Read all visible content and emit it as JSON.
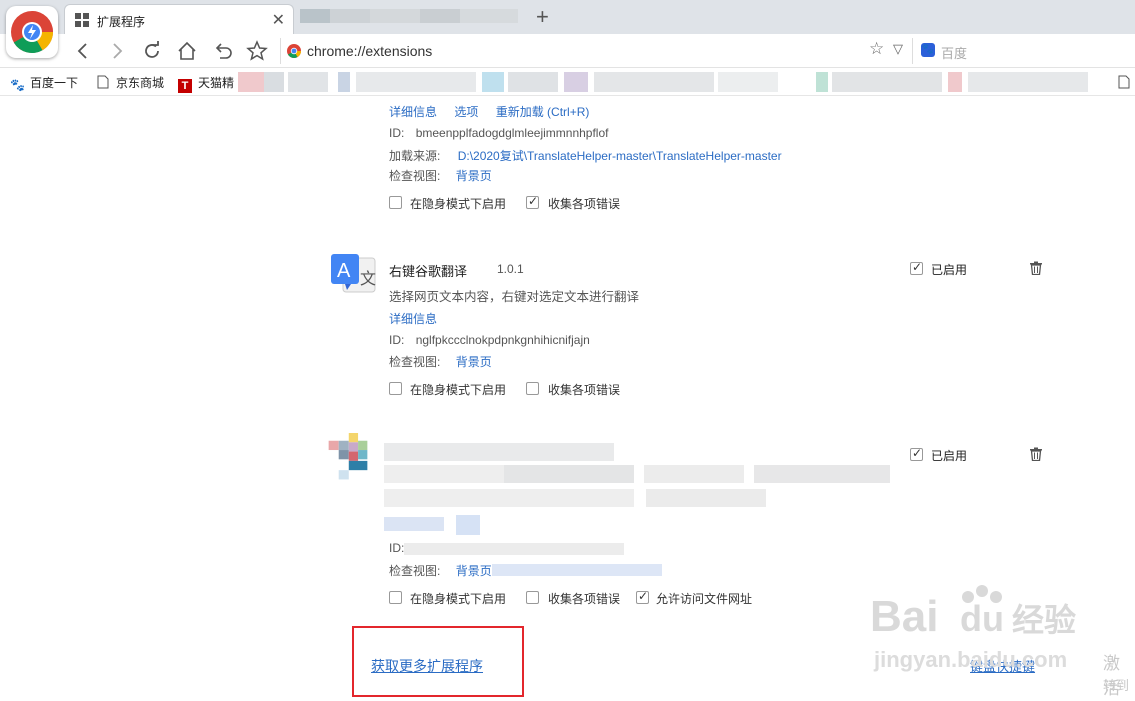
{
  "browser": {
    "tab_title": "扩展程序",
    "tab_close": "✕",
    "new_tab": "+",
    "url": "chrome://extensions",
    "search_placeholder": "百度",
    "omni_star": "☆",
    "omni_caret": "▽"
  },
  "bookmarks": [
    {
      "label": "百度一下",
      "icon": "baidu-paw-icon"
    },
    {
      "label": "京东商城",
      "icon": "page-icon"
    },
    {
      "label": "天猫精",
      "icon": "tmall-icon"
    }
  ],
  "ext1": {
    "links": [
      "详细信息",
      "选项",
      "重新加载 (Ctrl+R)"
    ],
    "id_label": "ID:",
    "id_value": "bmeenpplfadogdglmleejimmnnhpflof",
    "source_label": "加载来源:",
    "source_value": "D:\\2020复试\\TranslateHelper-master\\TranslateHelper-master",
    "views_label": "检查视图:",
    "views_link": "背景页",
    "incognito_label": "在隐身模式下启用",
    "incognito_checked": false,
    "errors_label": "收集各项错误",
    "errors_checked": true
  },
  "ext2": {
    "name": "右键谷歌翻译",
    "version": "1.0.1",
    "description": "选择网页文本内容，右键对选定文本进行翻译",
    "details_link": "详细信息",
    "id_label": "ID:",
    "id_value": "nglfpkccclnokpdpnkgnhihicnifjajn",
    "views_label": "检查视图:",
    "views_link": "背景页",
    "enabled_label": "已启用",
    "enabled": true,
    "incognito_label": "在隐身模式下启用",
    "incognito_checked": false,
    "errors_label": "收集各项错误",
    "errors_checked": false
  },
  "ext3": {
    "id_label": "ID:",
    "views_label": "检查视图:",
    "views_link": "背景页",
    "enabled_label": "已启用",
    "enabled": true,
    "incognito_label": "在隐身模式下启用",
    "incognito_checked": false,
    "errors_label": "收集各项错误",
    "errors_checked": false,
    "file_access_label": "允许访问文件网址",
    "file_access_checked": true
  },
  "footer": {
    "more_extensions": "获取更多扩展程序",
    "shortcuts": "键盘快捷键"
  },
  "overlay": {
    "activate": "激活",
    "goto": "转到"
  },
  "colors": {
    "link": "#2b6cc4",
    "highlight_box": "#e3262c"
  }
}
